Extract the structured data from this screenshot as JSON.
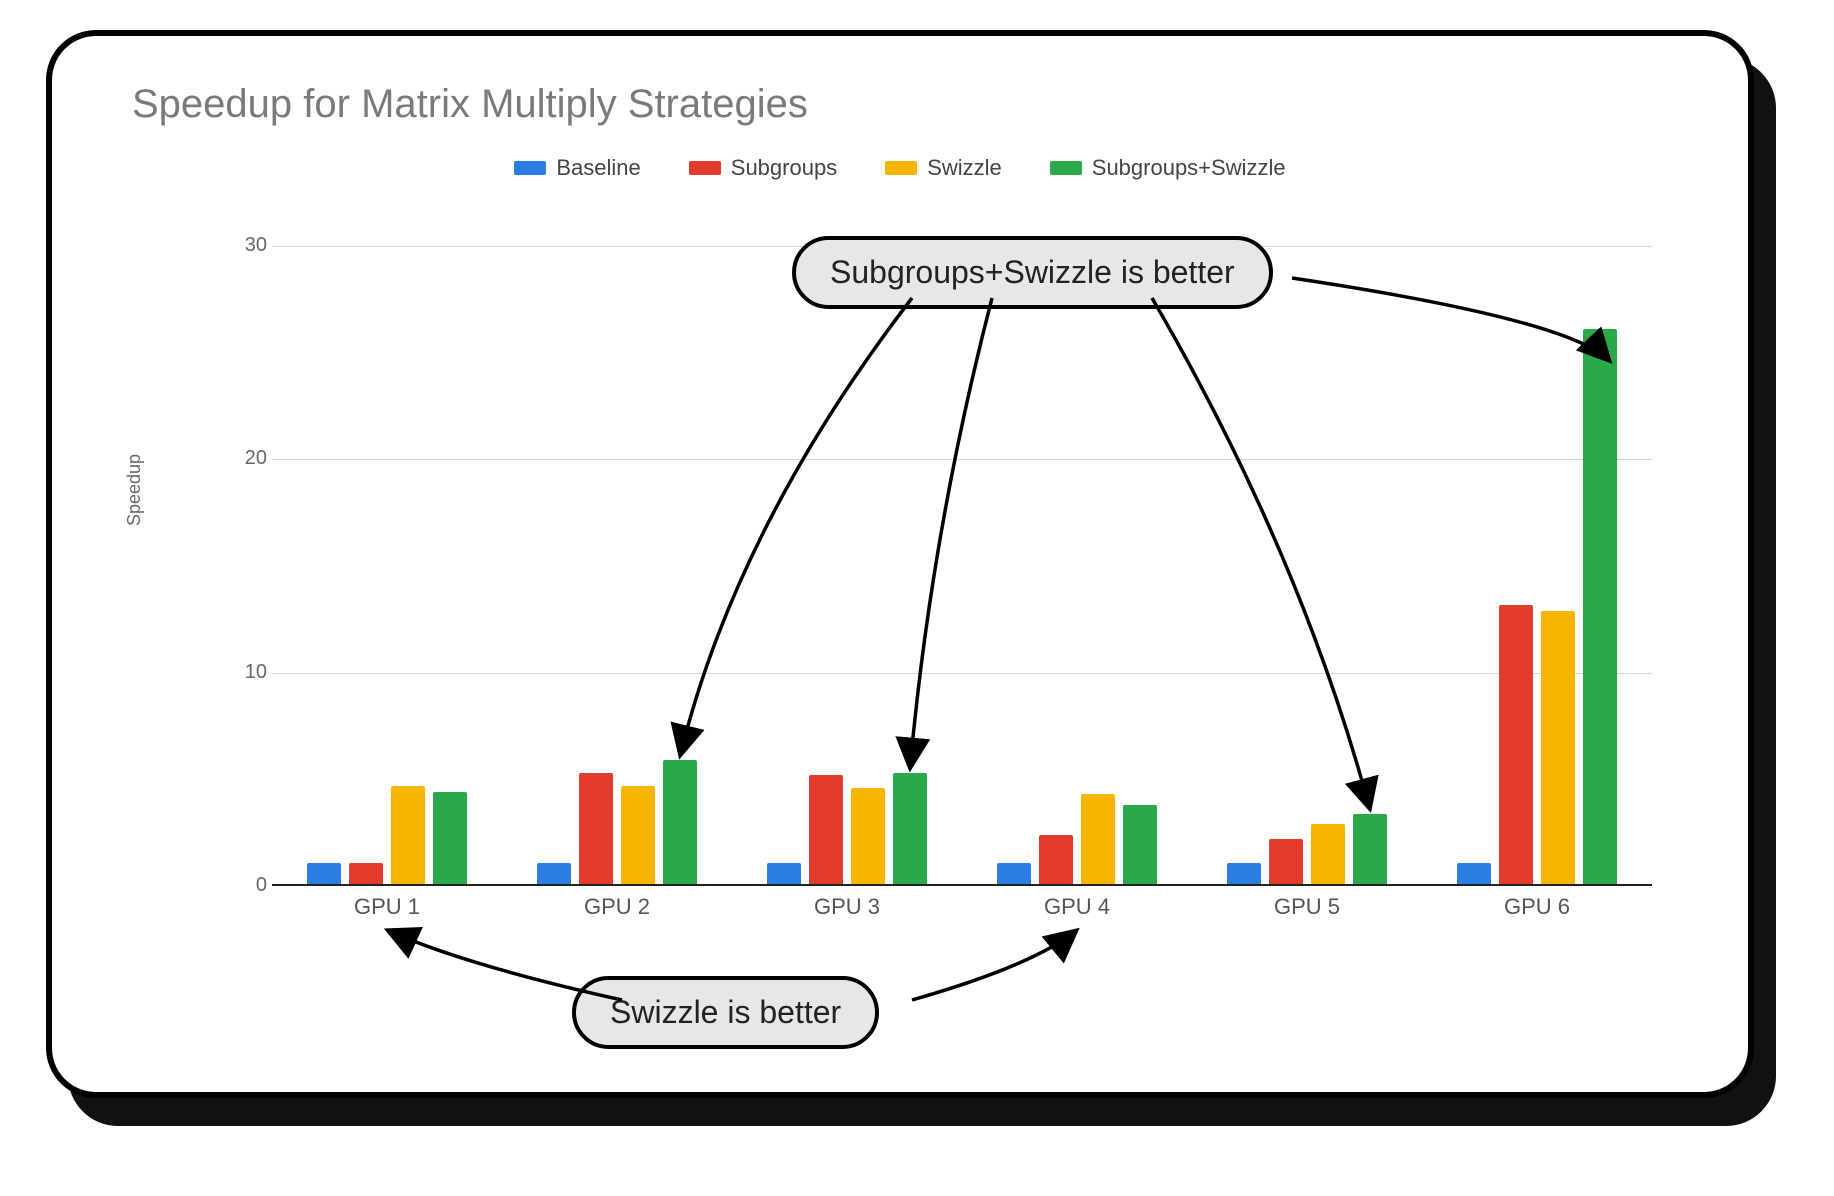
{
  "title": "Speedup for Matrix Multiply Strategies",
  "ylabel": "Speedup",
  "legend": [
    {
      "label": "Baseline",
      "color": "#2a7de1"
    },
    {
      "label": "Subgroups",
      "color": "#e23b2b"
    },
    {
      "label": "Swizzle",
      "color": "#f7b500"
    },
    {
      "label": "Subgroups+Swizzle",
      "color": "#2ba84a"
    }
  ],
  "callouts": {
    "top": "Subgroups+Swizzle is better",
    "bottom": "Swizzle is better"
  },
  "chart_data": {
    "type": "bar",
    "xlabel": "",
    "ylabel": "Speedup",
    "ylim": [
      0,
      30
    ],
    "yticks": [
      0,
      10,
      20,
      30
    ],
    "title": "Speedup for Matrix Multiply Strategies",
    "categories": [
      "GPU 1",
      "GPU 2",
      "GPU 3",
      "GPU 4",
      "GPU 5",
      "GPU 6"
    ],
    "series": [
      {
        "name": "Baseline",
        "color": "#2a7de1",
        "values": [
          1.0,
          1.0,
          1.0,
          1.0,
          1.0,
          1.0
        ]
      },
      {
        "name": "Subgroups",
        "color": "#e23b2b",
        "values": [
          1.0,
          5.2,
          5.1,
          2.3,
          2.1,
          13.1
        ]
      },
      {
        "name": "Swizzle",
        "color": "#f7b500",
        "values": [
          4.6,
          4.6,
          4.5,
          4.2,
          2.8,
          12.8
        ]
      },
      {
        "name": "Subgroups+Swizzle",
        "color": "#2ba84a",
        "values": [
          4.3,
          5.8,
          5.2,
          3.7,
          3.3,
          26.0
        ]
      }
    ],
    "annotations": [
      {
        "text": "Subgroups+Swizzle is better",
        "targets": [
          "GPU 2",
          "GPU 3",
          "GPU 5",
          "GPU 6"
        ]
      },
      {
        "text": "Swizzle is better",
        "targets": [
          "GPU 1",
          "GPU 4"
        ]
      }
    ]
  }
}
